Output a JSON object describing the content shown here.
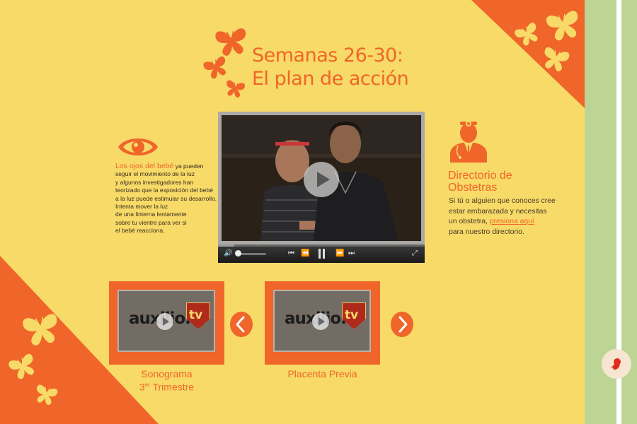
{
  "page": {
    "title_line1": "Semanas 26-30:",
    "title_line2": "El plan de acción"
  },
  "colors": {
    "accent": "#f0652a",
    "background": "#f7da67",
    "sidebar": "#bcd595",
    "butterfly": "#f7da67"
  },
  "eye_section": {
    "icon": "eye-icon",
    "highlight": "Los ojos del bebé",
    "lines": [
      " ya pueden",
      "seguir el movimiento de la luz",
      "y algunos investigadores han",
      "teorizado que la exposición del bebé",
      "a la luz puede estimular su desarrollo.",
      "Intenta mover la luz",
      "de una linterna lentamente",
      "sobre tu vientre para ver si",
      "el bebé reacciona."
    ]
  },
  "directory": {
    "icon": "doctor-icon",
    "title_line1": "Directorio de",
    "title_line2": "Obstetras",
    "text_line1": "Si tú o alguien que conoces cree",
    "text_line2": "estar embarazada y necesitas",
    "text_line3_pre": "un obstetra, ",
    "link": "presiona aquí",
    "text_line4": "para nuestro directorio."
  },
  "video": {
    "progress": 0.08,
    "volume": 0.0
  },
  "thumbnails": [
    {
      "logo_text": "auxilio.",
      "logo_badge": "tv",
      "label_line1": "Sonograma",
      "label_line2_main": "3",
      "label_line2_sup": "er",
      "label_line2_rest": " Trimestre"
    },
    {
      "logo_text": "auxilio.",
      "logo_badge": "tv",
      "label_line1": "Placenta Previa"
    }
  ],
  "nav": {
    "prev_icon": "chevron-left-icon",
    "next_icon": "chevron-right-icon"
  },
  "sidebar": {
    "knob_icon": "fetus-icon"
  }
}
